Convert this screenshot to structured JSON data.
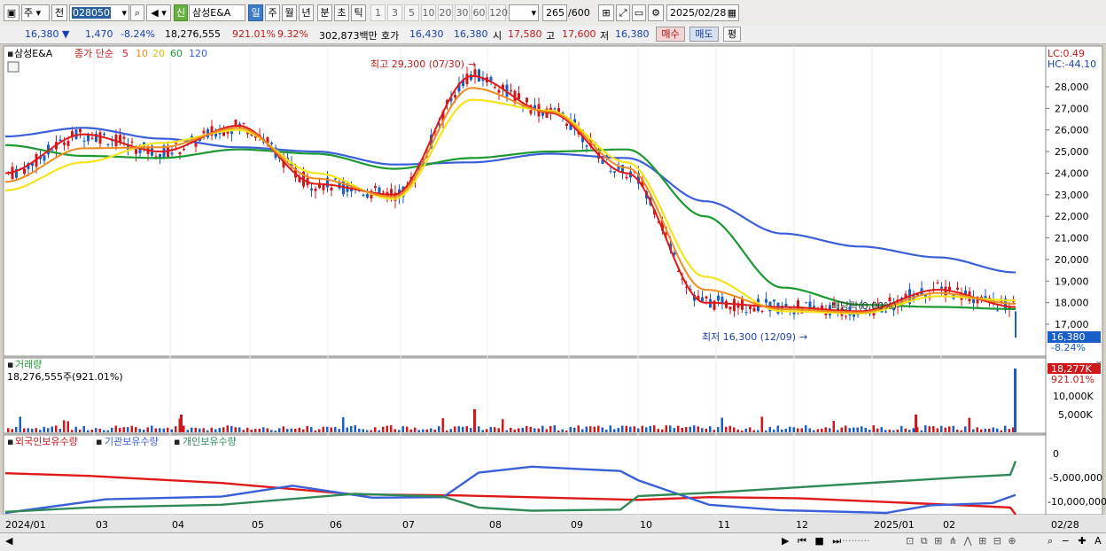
{
  "toolbar": {
    "period_combo": "주",
    "jeon_label": "전",
    "code": "028050",
    "stock_name": "삼성E&A",
    "new_badge": "신",
    "periods": [
      "일",
      "주",
      "월",
      "년",
      "분",
      "초",
      "틱"
    ],
    "selected_period": "일",
    "intervals": [
      "1",
      "3",
      "5",
      "10",
      "20",
      "30",
      "60",
      "120"
    ],
    "count": "265",
    "count_total": "/600",
    "date": "2025/02/28"
  },
  "quote": {
    "price": "16,380",
    "change_arrow": "▼",
    "change": "1,470",
    "change_pct": "-8.24%",
    "volume": "18,276,555",
    "volume_ratio": "921.01%",
    "turnover": "9.32%",
    "amount": "302,873백만",
    "ask_label": "호가",
    "ask1": "16,430",
    "ask2": "16,380",
    "open_label": "시",
    "open": "17,580",
    "high_label": "고",
    "high": "17,600",
    "low_label": "저",
    "low": "16,380",
    "buy_label": "매수",
    "sell_label": "매도",
    "avg_label": "평"
  },
  "price_panel": {
    "title": "삼성E&A",
    "ma_label": "종가 단순",
    "ma_periods": [
      "5",
      "10",
      "20",
      "60",
      "120"
    ],
    "lc": "LC:0.49",
    "hc": "HC:-44.10",
    "high_annotation": "최고 29,300 (07/30)",
    "low_annotation": "최저 16,300 (12/09)",
    "event_annotation": "배당락(0.00%)",
    "current_tag": "16,380",
    "current_pct": "-8.24%",
    "y_ticks": [
      "28,000",
      "27,000",
      "26,000",
      "25,000",
      "24,000",
      "23,000",
      "22,000",
      "21,000",
      "20,000",
      "19,000",
      "18,000",
      "17,000"
    ]
  },
  "volume_panel": {
    "title": "거래량",
    "value": "18,276,555주(921.01%)",
    "current_tag": "18,277K",
    "current_pct": "921.01%",
    "y_ticks": [
      "10,000K",
      "5,000K"
    ]
  },
  "holdings_panel": {
    "legend": [
      "외국인보유수량",
      "기관보유수량",
      "개인보유수량"
    ],
    "y_ticks": [
      "0",
      "-5,000,000",
      "-10,000,000"
    ]
  },
  "x_axis": [
    "2024/01",
    "03",
    "04",
    "05",
    "06",
    "07",
    "08",
    "09",
    "10",
    "11",
    "12",
    "2025/01",
    "02",
    "02/28"
  ],
  "colors": {
    "ma5": "#e01818",
    "ma10": "#f08c1e",
    "ma20": "#f4e41a",
    "ma60": "#1c9a32",
    "ma120": "#3a5fd8",
    "up": "#d0181c",
    "down": "#1a5ec8",
    "foreign": "#e01818",
    "institution": "#3a5fd8",
    "individual": "#2e8b57"
  },
  "chart_data": {
    "type": "candlestick",
    "price_range": [
      16300,
      29300
    ],
    "ma_close_values": {
      "dates": [
        "2024/01",
        "03",
        "04",
        "05",
        "06",
        "07",
        "08",
        "09",
        "10",
        "11",
        "12",
        "2025/01",
        "02",
        "02/28"
      ],
      "ma5": [
        24000,
        25800,
        25000,
        26200,
        23500,
        23000,
        28500,
        26800,
        24000,
        18000,
        17800,
        17600,
        18600,
        17800
      ],
      "ma20": [
        23200,
        24500,
        25400,
        26000,
        24000,
        22800,
        27400,
        26900,
        24500,
        19200,
        17600,
        17500,
        18300,
        18100
      ],
      "ma60": [
        25300,
        24800,
        24700,
        25100,
        24900,
        24200,
        24700,
        25000,
        25100,
        22000,
        18700,
        17900,
        17800,
        17700
      ],
      "ma120": [
        25700,
        26100,
        25600,
        25200,
        25000,
        24400,
        24500,
        24900,
        24700,
        22700,
        21200,
        20600,
        20100,
        19400
      ]
    },
    "holdings_y_range": [
      -12000000,
      2000000
    ]
  }
}
